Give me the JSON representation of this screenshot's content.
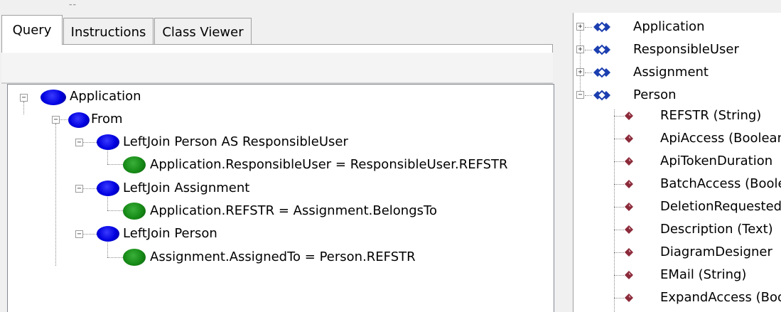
{
  "tabs": [
    {
      "label": "Query",
      "active": true
    },
    {
      "label": "Instructions",
      "active": false
    },
    {
      "label": "Class Viewer",
      "active": false
    }
  ],
  "query_tree": {
    "root": "Application",
    "from": "From",
    "joins": [
      {
        "label": "LeftJoin  Person AS ResponsibleUser",
        "condition": "Application.ResponsibleUser = ResponsibleUser.REFSTR"
      },
      {
        "label": "LeftJoin  Assignment",
        "condition": "Application.REFSTR = Assignment.BelongsTo"
      },
      {
        "label": "LeftJoin  Person",
        "condition": "Assignment.AssignedTo = Person.REFSTR"
      }
    ]
  },
  "class_viewer": {
    "classes": [
      {
        "label": "Application",
        "expanded": false
      },
      {
        "label": "ResponsibleUser",
        "expanded": false
      },
      {
        "label": "Assignment",
        "expanded": false
      },
      {
        "label": "Person",
        "expanded": true
      }
    ],
    "person_attributes": [
      "REFSTR (String)",
      "ApiAccess (Boolean)",
      "ApiTokenDuration",
      "BatchAccess (Boolean)",
      "DeletionRequested",
      "Description (Text)",
      "DiagramDesigner",
      "EMail (String)",
      "ExpandAccess (Boolean)"
    ]
  },
  "colors": {
    "query_node": "#0000e0",
    "condition_node": "#168a16",
    "class_icon": "#1c3fb0",
    "attribute_icon": "#8b2a3a"
  },
  "icons": {
    "query_node": "blue-node-icon",
    "condition_node": "green-condition-icon",
    "class": "class-diamond-icon",
    "attribute": "attribute-diamond-icon",
    "expand": "plus-expander-icon",
    "collapse": "minus-expander-icon"
  }
}
